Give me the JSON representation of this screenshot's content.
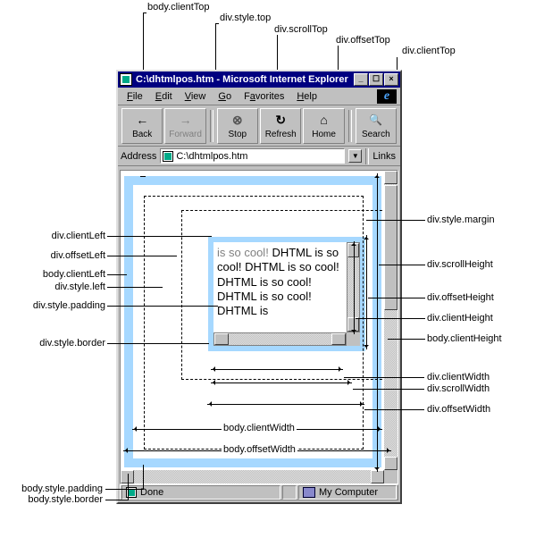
{
  "window": {
    "title": "C:\\dhtmlpos.htm - Microsoft Internet Explorer",
    "min_label": "_",
    "max_label": "☐",
    "close_label": "×"
  },
  "menu": {
    "file": "File",
    "edit": "Edit",
    "view": "View",
    "go": "Go",
    "favorites": "Favorites",
    "help": "Help",
    "logo_glyph": "e"
  },
  "toolbar": {
    "back": "Back",
    "forward": "Forward",
    "stop": "Stop",
    "refresh": "Refresh",
    "home": "Home",
    "search": "Search",
    "back_glyph": "←",
    "forward_glyph": "→",
    "stop_glyph": "⊗",
    "refresh_glyph": "↻",
    "home_glyph": "⌂",
    "search_glyph": "🔍"
  },
  "address": {
    "label": "Address",
    "value": "C:\\dhtmlpos.htm",
    "dropdown_glyph": "▼",
    "links_label": "Links"
  },
  "status": {
    "done": "Done",
    "zone": "My Computer"
  },
  "page": {
    "inner_text_dimmed": "is so cool!",
    "inner_text": "DHTML is so cool! DHTML is so cool! DHTML is so cool! DHTML is so cool! DHTML is"
  },
  "labels": {
    "body_clientTop": "body.clientTop",
    "div_style_top": "div.style.top",
    "div_scrollTop": "div.scrollTop",
    "div_offsetTop": "div.offsetTop",
    "div_clientTop": "div.clientTop",
    "div_clientLeft": "div.clientLeft",
    "div_offsetLeft": "div.offsetLeft",
    "body_clientLeft": "body.clientLeft",
    "div_style_left": "div.style.left",
    "div_style_padding": "div.style.padding",
    "div_style_border": "div.style.border",
    "div_style_margin": "div.style.margin",
    "div_scrollHeight": "div.scrollHeight",
    "div_offsetHeight": "div.offsetHeight",
    "div_clientHeight": "div.clientHeight",
    "body_clientHeight": "body.clientHeight",
    "div_clientWidth": "div.clientWidth",
    "div_scrollWidth": "div.scrollWidth",
    "div_offsetWidth": "div.offsetWidth",
    "body_clientWidth": "body.clientWidth",
    "body_offsetWidth": "body.offsetWidth",
    "body_style_padding": "body.style.padding",
    "body_style_border": "body.style.border"
  }
}
